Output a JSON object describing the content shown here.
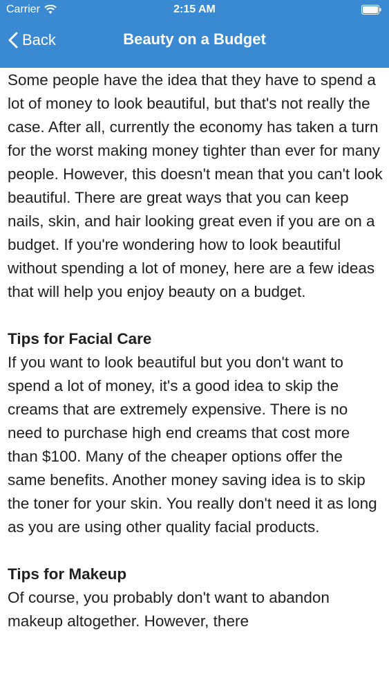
{
  "status_bar": {
    "carrier": "Carrier",
    "time": "2:15 AM",
    "wifi_icon": "wifi-icon",
    "battery_icon": "battery-icon"
  },
  "nav": {
    "back_label": "Back",
    "title": "Beauty on a Budget",
    "bar_color": "#3a8ad3"
  },
  "article": {
    "intro": "Some people have the idea that they have to spend a lot of money to look beautiful, but that's not really the case. After all, currently the economy has taken a turn for the worst making money tighter than ever for many people. However, this doesn't mean that you can't look beautiful. There are great ways that you can keep nails, skin, and hair looking great even if you are on a budget. If you're wondering how to look beautiful without spending a lot of money, here are a few ideas that will help you enjoy beauty on a budget.",
    "sections": [
      {
        "heading": "Tips for Facial Care",
        "body": "If you want to look beautiful but you don't want to spend a lot of money, it's a good idea to skip the creams that are extremely expensive. There is no need to purchase high end creams that cost more than $100. Many of the cheaper options offer the same benefits. Another money saving idea is to skip the toner for your skin. You really don't need it as long as you are using other quality facial products."
      },
      {
        "heading": "Tips for Makeup",
        "body": "Of course, you probably don't want to abandon makeup altogether. However, there"
      }
    ]
  }
}
